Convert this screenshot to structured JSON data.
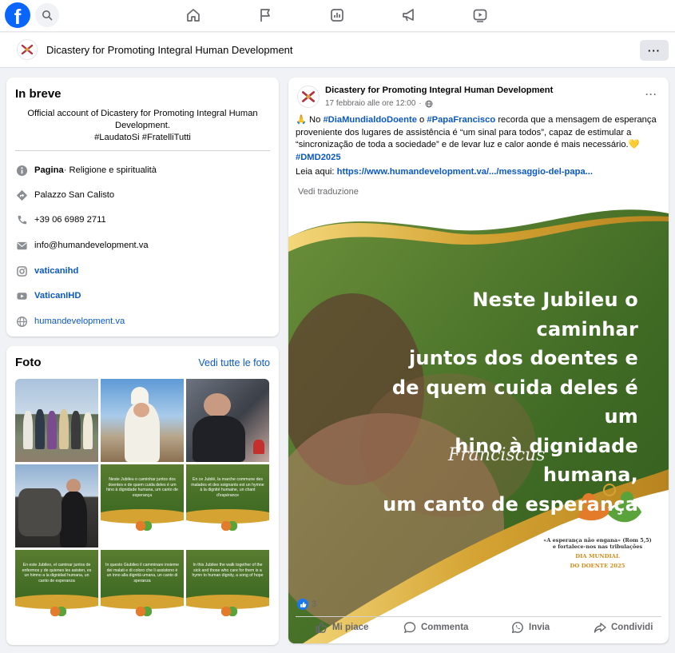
{
  "colors": {
    "brand": "#0866ff",
    "link": "#0b58c5",
    "green": "#3e6a22",
    "gold": "#d4a332"
  },
  "topbar": {
    "logo": "f",
    "icons": [
      "search-icon",
      "home-icon",
      "flag-icon",
      "insights-icon",
      "megaphone-icon",
      "video-icon"
    ]
  },
  "pagebar": {
    "page_name": "Dicastery for Promoting Integral Human Development",
    "more": "···"
  },
  "intro": {
    "title": "In breve",
    "bio_line1": "Official account of Dicastery for Promoting Integral Human",
    "bio_line2": "Development.",
    "bio_line3": "#LaudatoSi #FratelliTutti",
    "category_bold": "Pagina",
    "category_rest": " · Religione e spiritualità",
    "address": "Palazzo San Calisto",
    "phone": "+39 06 6989 2711",
    "email": "info@humandevelopment.va",
    "instagram": "vaticanihd",
    "youtube": "VaticanIHD",
    "website": "humandevelopment.va"
  },
  "photos": {
    "title": "Foto",
    "see_all": "Vedi tutte le foto",
    "tiles": [
      {
        "text": ""
      },
      {
        "text": ""
      },
      {
        "text": ""
      },
      {
        "text": ""
      },
      {
        "text": "Neste Jubileu o caminhar juntos dos doentes e de quem cuida deles é um hino à dignidade humana, um canto de esperança"
      },
      {
        "text": "En ce Jubilé, la marche commune des malades et des soignants est un hymne à la dignité humaine, un chant d'espérance"
      },
      {
        "text": "En este Jubileo, el caminar juntos de enfermos y de quienes les asisten, es un himno a la dignidad humana, un canto de esperanza"
      },
      {
        "text": "In questo Giubileo il camminare insieme dei malati e di coloro che li assistono è un inno alla dignità umana, un canto di speranza"
      },
      {
        "text": "In this Jubilee the walk together of the sick and those who care for them is a hymn to human dignity, a song of hope"
      }
    ]
  },
  "post": {
    "author": "Dicastery for Promoting Integral Human Development",
    "date": "17 febbraio alle ore 12:00",
    "more": "···",
    "t_prefix": "🙏 No ",
    "t_tag1": "#DiaMundialdoDoente",
    "t_o": " o ",
    "t_tag2": "#PapaFrancisco",
    "t_body": " recorda que a mensagem de esperança proveniente dos lugares de assistência é “um sinal para todos”, capaz de estimular a “sincronização de toda a sociedade” e de levar luz e calor aonde é mais necessário.💛",
    "t_tag3": "#DMD2025",
    "read_label": "Leia aqui: ",
    "read_link": "https://www.humandevelopment.va/.../messaggio-del-papa...",
    "translate": "Vedi traduzione",
    "image": {
      "quote_l1": "Neste Jubileu o caminhar",
      "quote_l2": "juntos dos doentes e",
      "quote_l3": "de quem cuida deles é um",
      "quote_l4": "hino à dignidade humana,",
      "quote_l5": "um canto de esperança",
      "signature": "Franciscus",
      "motto_l1": "«A esperança não engana» (Rom 5,5)",
      "motto_l2": "e fortalece-nos nas tribulações",
      "event_l1": "DIA MUNDIAL",
      "event_l2": "DO DOENTE 2025"
    },
    "reaction_count": "3",
    "actions": {
      "like": "Mi piace",
      "comment": "Commenta",
      "send": "Invia",
      "share": "Condividi"
    }
  }
}
